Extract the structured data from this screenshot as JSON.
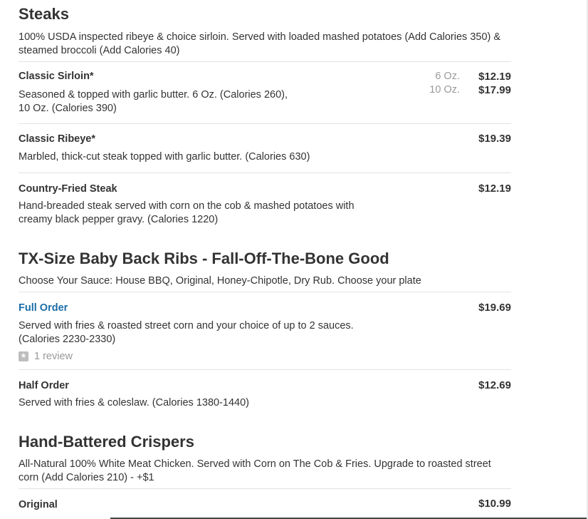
{
  "sections": [
    {
      "title": "Steaks",
      "description": "100% USDA inspected ribeye & choice sirloin. Served with loaded mashed potatoes (Add Calories 350) & steamed broccoli (Add Calories 40)",
      "items": [
        {
          "name": "Classic Sirloin*",
          "description": "Seasoned & topped with garlic butter. 6 Oz. (Calories 260), 10 Oz. (Calories 390)",
          "sizes": [
            {
              "size": "6 Oz.",
              "price": "$12.19"
            },
            {
              "size": "10 Oz.",
              "price": "$17.99"
            }
          ]
        },
        {
          "name": "Classic Ribeye*",
          "description": "Marbled, thick-cut steak topped with garlic butter. (Calories 630)",
          "price": "$19.39"
        },
        {
          "name": "Country-Fried Steak",
          "description": "Hand-breaded steak served with corn on the cob & mashed potatoes with creamy black pepper gravy. (Calories 1220)",
          "price": "$12.19"
        }
      ]
    },
    {
      "title": "TX-Size Baby Back Ribs - Fall-Off-The-Bone Good",
      "description": "Choose Your Sauce: House BBQ, Original, Honey-Chipotle, Dry Rub. Choose your plate",
      "items": [
        {
          "name": "Full Order",
          "description": "Served with fries & roasted street corn and your choice of up to 2 sauces. (Calories 2230-2330)",
          "price": "$19.69",
          "review": "1 review"
        },
        {
          "name": "Half Order",
          "description": "Served with fries & coleslaw. (Calories 1380-1440)",
          "price": "$12.69"
        }
      ]
    },
    {
      "title": "Hand-Battered Crispers",
      "description": "All-Natural 100% White Meat Chicken. Served with Corn on The Cob & Fries. Upgrade to roasted street corn (Add Calories 210) - +$1",
      "items": [
        {
          "name": "Original",
          "price": "$10.99"
        }
      ]
    }
  ],
  "icons": {
    "review": "star-icon"
  }
}
